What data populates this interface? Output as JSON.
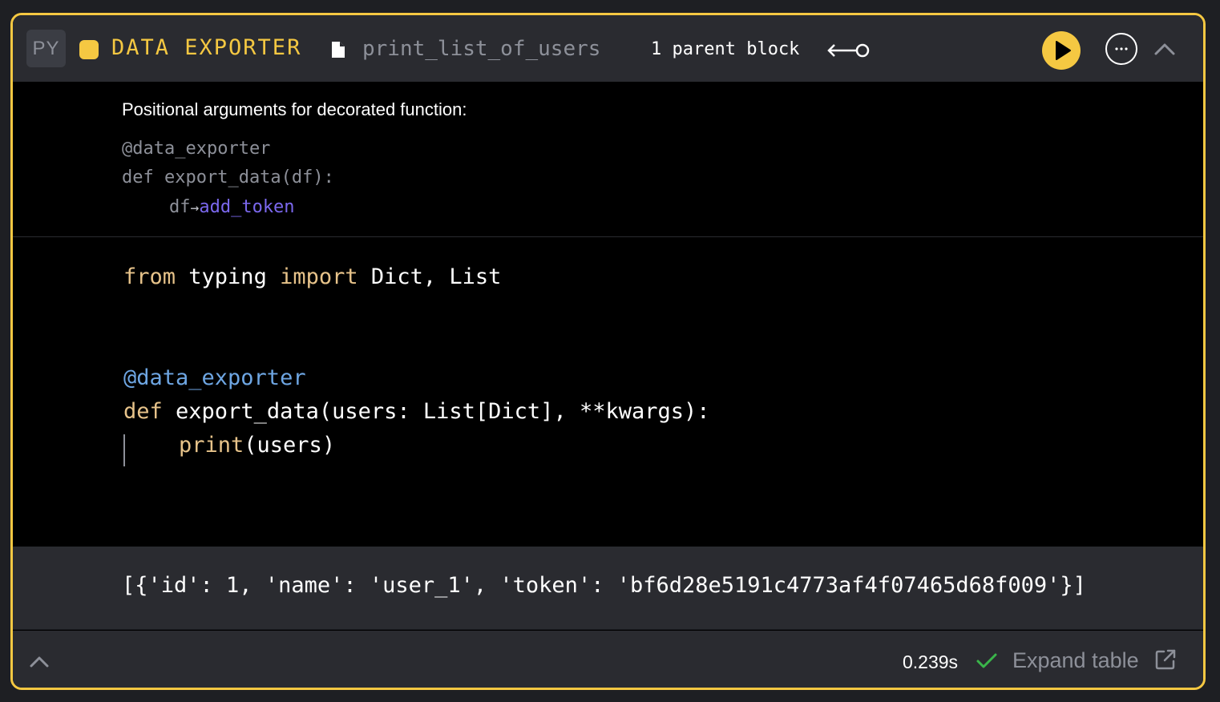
{
  "header": {
    "language": "PY",
    "block_type": "DATA EXPORTER",
    "block_name": "print_list_of_users",
    "parent_count_label": "1 parent block",
    "accent_color": "#f5c842"
  },
  "args": {
    "title": "Positional arguments for decorated function:",
    "decorator": "@data_exporter",
    "signature": "def export_data(df):",
    "param": "df",
    "arrow": "→",
    "upstream_block": "add_token"
  },
  "code": {
    "lines": [
      {
        "kw1": "from",
        "mod": " typing ",
        "kw2": "import",
        "rest": " Dict, List"
      },
      {
        "decorator": "@data_exporter"
      },
      {
        "kw": "def",
        "rest": " export_data(users: List[Dict], **kwargs):"
      },
      {
        "fn": "print",
        "rest": "(users)"
      }
    ]
  },
  "output": {
    "text": "[{'id': 1, 'name': 'user_1', 'token': 'bf6d28e5191c4773af4f07465d68f009'}]"
  },
  "footer": {
    "exec_time": "0.239s",
    "expand_label": "Expand table"
  }
}
